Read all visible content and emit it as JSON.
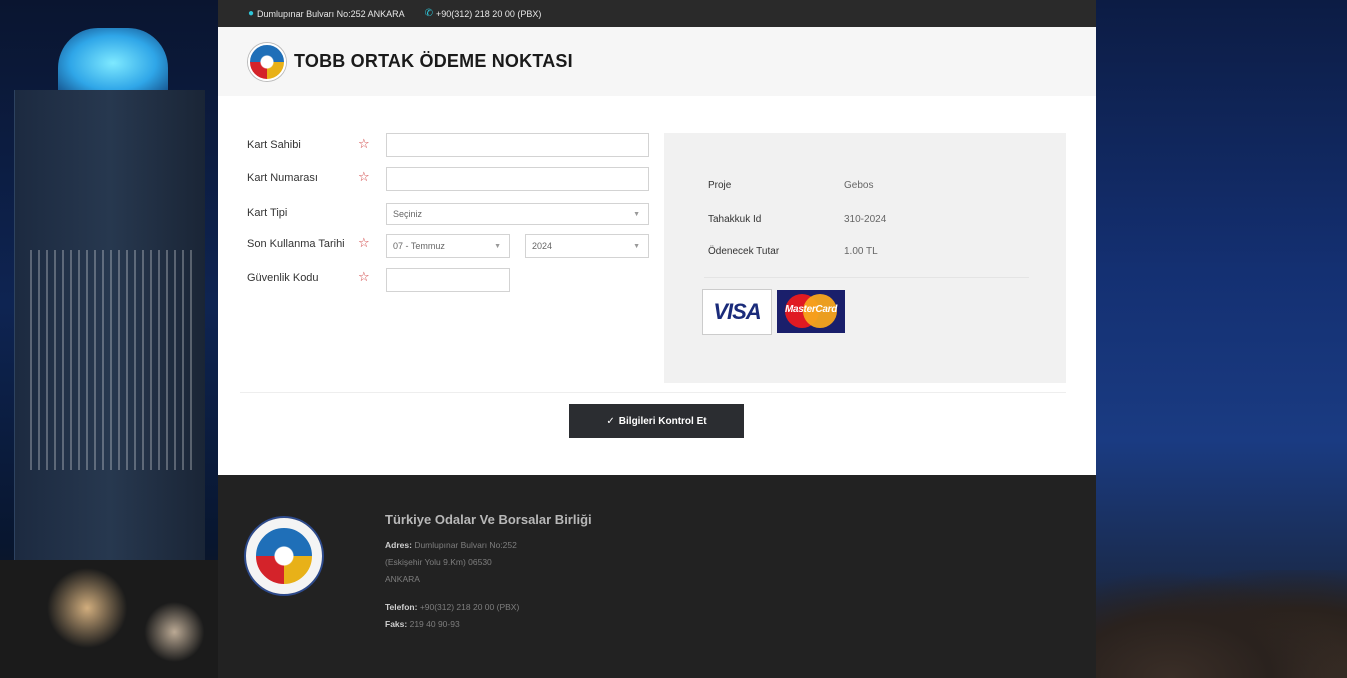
{
  "topbar": {
    "address": "Dumlupınar Bulvarı No:252 ANKARA",
    "phone": "+90(312) 218 20 00 (PBX)"
  },
  "brand": {
    "title": "TOBB ORTAK ÖDEME NOKTASI"
  },
  "form": {
    "card_holder_label": "Kart Sahibi",
    "card_number_label": "Kart Numarası",
    "card_type_label": "Kart Tipi",
    "card_type_selected": "Seçiniz",
    "expiry_label": "Son Kullanma Tarihi",
    "expiry_month_selected": "07 - Temmuz",
    "expiry_year_selected": "2024",
    "security_code_label": "Güvenlik Kodu",
    "submit_label": "Bilgileri Kontrol Et"
  },
  "summary": {
    "project_label": "Proje",
    "project_value": "Gebos",
    "accrual_label": "Tahakkuk Id",
    "accrual_value": "310-2024",
    "amount_label": "Ödenecek Tutar",
    "amount_value": "1.00 TL",
    "visa_text": "VISA",
    "mastercard_text": "MasterCard"
  },
  "footer": {
    "org_name": "Türkiye Odalar Ve Borsalar Birliği",
    "address_label": "Adres:",
    "address_line1": "Dumlupınar Bulvarı No:252",
    "address_line2": "(Eskişehir Yolu 9.Km) 06530",
    "address_line3": "ANKARA",
    "phone_label": "Telefon:",
    "phone_value": "+90(312) 218 20 00 (PBX)",
    "fax_label": "Faks:",
    "fax_value": "219 40 90-93"
  },
  "colors": {
    "topbar_bg": "#2a2a2a",
    "accent": "#2fc6d8",
    "required_star": "#cf3b3b",
    "button_bg": "#2b2d31",
    "footer_bg": "#222222"
  }
}
